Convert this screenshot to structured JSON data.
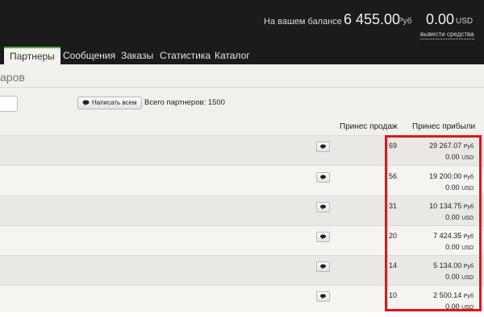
{
  "header": {
    "balance_label": "На вашем балансе",
    "balance_rub": "6 455.00",
    "balance_rub_currency": "Руб",
    "balance_usd": "0.00",
    "balance_usd_currency": "USD",
    "withdraw_link": "вывести средства"
  },
  "nav": {
    "tabs": [
      {
        "label": "Партнеры",
        "active": true
      },
      {
        "label": "Сообщения"
      },
      {
        "label": "Заказы"
      },
      {
        "label": "Статистика"
      },
      {
        "label": "Каталог"
      }
    ]
  },
  "page": {
    "title": "аров",
    "message_all_button": "Написать всем",
    "partners_total": "Всего партнеров: 1500"
  },
  "table": {
    "columns": {
      "sales": "Принес продаж",
      "profit": "Принес прибыли"
    },
    "rows": [
      {
        "sales": "69",
        "profit_rub": "29 267.07",
        "rub_cur": "Руб",
        "profit_usd": "0.00",
        "usd_cur": "USD"
      },
      {
        "sales": "56",
        "profit_rub": "19 200.00",
        "rub_cur": "Руб",
        "profit_usd": "0.00",
        "usd_cur": "USD"
      },
      {
        "sales": "31",
        "profit_rub": "10 134.75",
        "rub_cur": "Руб",
        "profit_usd": "0.00",
        "usd_cur": "USD"
      },
      {
        "sales": "20",
        "profit_rub": "7 424.35",
        "rub_cur": "Руб",
        "profit_usd": "0.00",
        "usd_cur": "USD"
      },
      {
        "sales": "14",
        "profit_rub": "5 134.00",
        "rub_cur": "Руб",
        "profit_usd": "0.00",
        "usd_cur": "USD"
      },
      {
        "sales": "10",
        "profit_rub": "2 500.14",
        "rub_cur": "Руб",
        "profit_usd": "0.00",
        "usd_cur": "USD"
      }
    ]
  },
  "colors": {
    "header_bg": "#1b1b1b",
    "active_tab_accent": "#5aa84a",
    "highlight_border": "#e0151c",
    "content_bg": "#f1f0ed"
  },
  "icons": {
    "message_all": "speech-bubble-icon",
    "row_message": "speech-bubble-icon"
  }
}
